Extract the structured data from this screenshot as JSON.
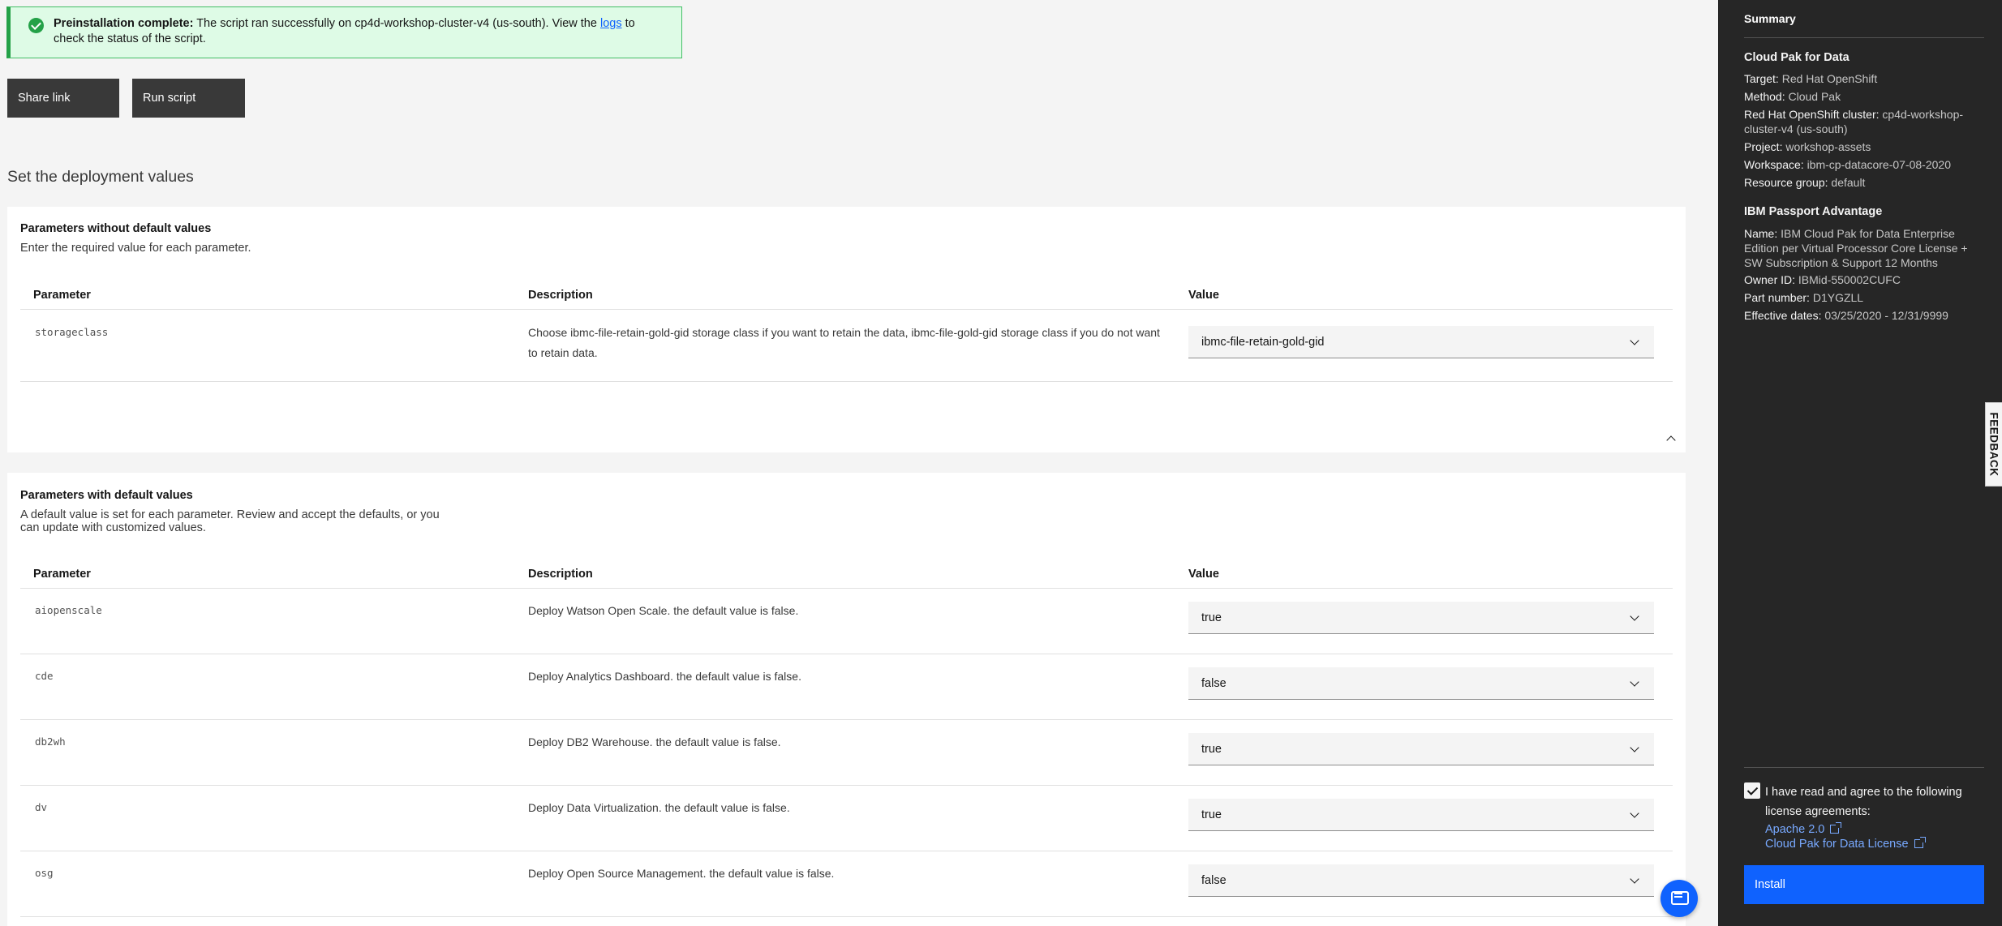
{
  "notification": {
    "title": "Preinstallation complete:",
    "text_before_link": " The script ran successfully on cp4d-workshop-cluster-v4 (us-south). View the ",
    "link": "logs",
    "text_after_link": " to check the status of the script.",
    "icon": "checkmark-filled-icon",
    "color": "#24a148"
  },
  "actions": {
    "share_label": "Share link",
    "run_label": "Run script"
  },
  "page_heading": "Set the deployment values",
  "no_default": {
    "title": "Parameters without default values",
    "subtitle": "Enter the required value for each parameter.",
    "columns": [
      "Parameter",
      "Description",
      "Value"
    ],
    "rows": [
      {
        "param": "storageclass",
        "description": "Choose ibmc-file-retain-gold-gid storage class if you want to retain the data, ibmc-file-gold-gid storage class if you do not want to retain data.",
        "value": "ibmc-file-retain-gold-gid"
      }
    ]
  },
  "with_default": {
    "title": "Parameters with default values",
    "subtitle": "A default value is set for each parameter. Review and accept the defaults, or you can update with customized values.",
    "columns": [
      "Parameter",
      "Description",
      "Value"
    ],
    "rows": [
      {
        "param": "aiopenscale",
        "description": "Deploy Watson Open Scale. the default value is false.",
        "value": "true"
      },
      {
        "param": "cde",
        "description": "Deploy Analytics Dashboard. the default value is false.",
        "value": "false"
      },
      {
        "param": "db2wh",
        "description": "Deploy DB2 Warehouse. the default value is false.",
        "value": "true"
      },
      {
        "param": "dv",
        "description": "Deploy Data Virtualization. the default value is false.",
        "value": "true"
      },
      {
        "param": "osg",
        "description": "Deploy Open Source Management. the default value is false.",
        "value": "false"
      }
    ]
  },
  "summary": {
    "title": "Summary",
    "cloud_pak": {
      "heading": "Cloud Pak for Data",
      "target_k": "Target:",
      "target_v": "Red Hat OpenShift",
      "method_k": "Method:",
      "method_v": "Cloud Pak",
      "cluster_k": "Red Hat OpenShift cluster:",
      "cluster_v": "cp4d-workshop-cluster-v4 (us-south)",
      "project_k": "Project:",
      "project_v": "workshop-assets",
      "workspace_k": "Workspace:",
      "workspace_v": "ibm-cp-datacore-07-08-2020",
      "rg_k": "Resource group:",
      "rg_v": "default"
    },
    "passport": {
      "heading": "IBM Passport Advantage",
      "name_k": "Name:",
      "name_v": "IBM Cloud Pak for Data Enterprise Edition per Virtual Processor Core License + SW Subscription & Support 12 Months",
      "owner_k": "Owner ID:",
      "owner_v": "IBMid-550002CUFC",
      "part_k": "Part number:",
      "part_v": "D1YGZLL",
      "dates_k": "Effective dates:",
      "dates_v": "03/25/2020 - 12/31/9999"
    },
    "agree_text": "I have read and agree to the following license agreements:",
    "license_1": "Apache 2.0",
    "license_2": "Cloud Pak for Data License",
    "install_label": "Install"
  },
  "feedback_label": "FEEDBACK",
  "colors": {
    "accent": "#0f62fe",
    "sidebar": "#262626",
    "success": "#24a148"
  }
}
